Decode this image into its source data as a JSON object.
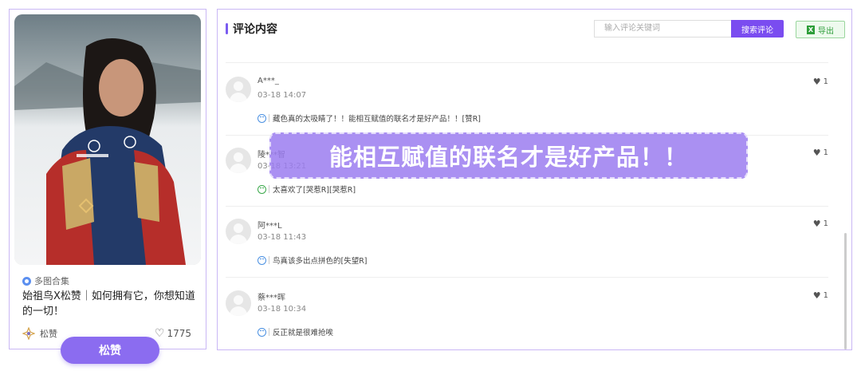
{
  "card": {
    "badge": "多图合集",
    "title": "始祖鸟X松赞｜如何拥有它，你想知道的一切！",
    "author": "松赞",
    "likes": "1775",
    "tag": "松赞"
  },
  "panel": {
    "title": "评论内容",
    "search_placeholder": "输入评论关键词",
    "search_button": "搜索评论",
    "export_button": "导出"
  },
  "comments": [
    {
      "name": "A***_",
      "time": "03-18 14:07",
      "text": "藏色真的太吸睛了！！能相互赋值的联名才是好产品！！[赞R]",
      "likes": "1"
    },
    {
      "name": "陵***智",
      "time": "03-18 13:21",
      "text": "太喜欢了[哭惹R][哭惹R]",
      "likes": "1"
    },
    {
      "name": "阿***L",
      "time": "03-18 11:43",
      "text": "鸟真该多出点拼色的[失望R]",
      "likes": "1"
    },
    {
      "name": "蔡***晖",
      "time": "03-18 10:34",
      "text": "反正就是很难抢唉",
      "likes": "1"
    }
  ],
  "overlay": "能相互赋值的联名才是好产品！！",
  "colors": {
    "accent": "#7a4cf0",
    "export_green": "#2e9e3a"
  }
}
